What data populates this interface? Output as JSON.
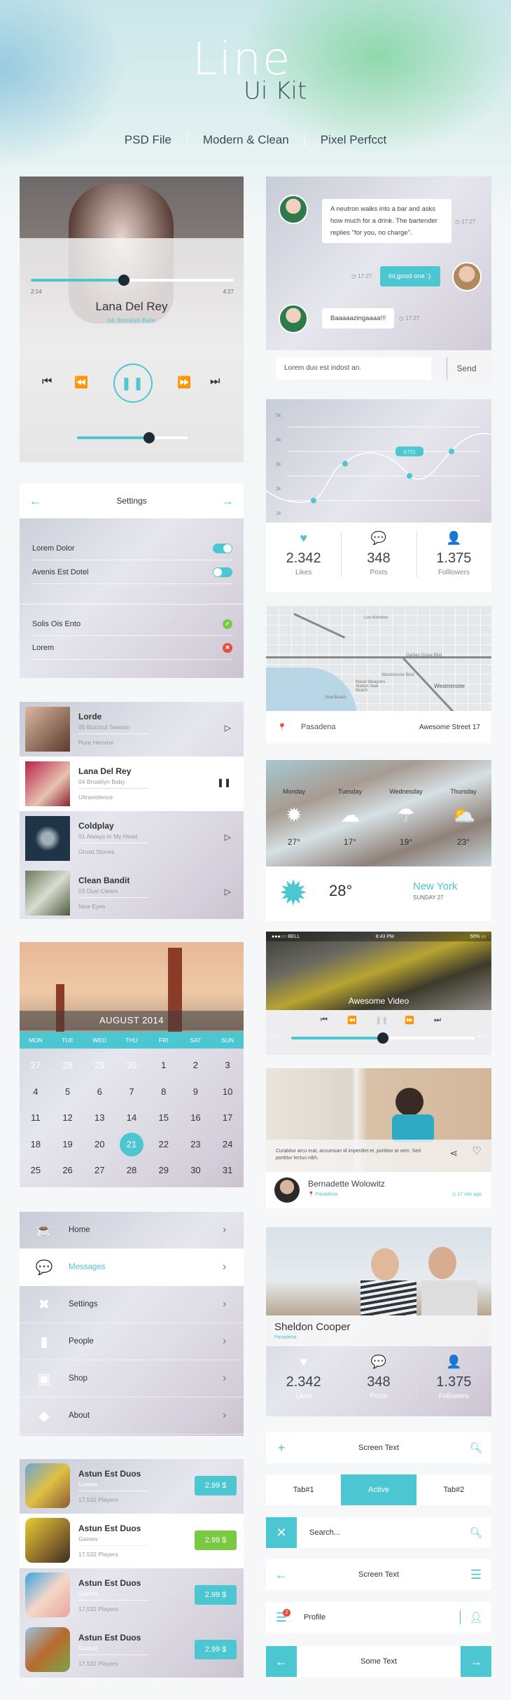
{
  "header": {
    "title_line1": "Line",
    "title_line2": "Ui Kit",
    "features": [
      "PSD File",
      "Modern & Clean",
      "Pixel Perfcct"
    ]
  },
  "colors": {
    "accent": "#4cc7d1",
    "success": "#7ac943",
    "danger": "#e74c3c",
    "text": "#3a4450"
  },
  "music_player": {
    "elapsed": "2:14",
    "duration": "4:27",
    "progress": 0.46,
    "artist": "Lana Del Rey",
    "track": "04. Brooklyn Baby",
    "volume": 0.65,
    "controls": [
      "skip-previous",
      "rewind",
      "pause",
      "fast-forward",
      "skip-next"
    ]
  },
  "chat": {
    "messages": [
      {
        "from": "left",
        "text": "A neutron walks into a bar and asks how much for a drink. The bartender replies \"for you, no charge\".",
        "time": "17:27"
      },
      {
        "from": "right",
        "text": "lol,good one :)",
        "time": "17:27"
      },
      {
        "from": "left",
        "text": "Baaaaazingaaaa!!!",
        "time": "17:27"
      }
    ],
    "input_value": "Lorem duo est indost an.",
    "send_label": "Send"
  },
  "stats_card": {
    "tooltip": "3.721",
    "stats": [
      {
        "icon": "heart-icon",
        "value": "2.342",
        "label": "Likes"
      },
      {
        "icon": "chat-bubbles-icon",
        "value": "348",
        "label": "Posts"
      },
      {
        "icon": "user-icon",
        "value": "1.375",
        "label": "Folllowers"
      }
    ]
  },
  "chart_data": {
    "type": "line",
    "title": "",
    "xlabel": "",
    "ylabel": "",
    "yticks": [
      "5k",
      "4k",
      "3k",
      "2k",
      "1k"
    ],
    "ylim": [
      1000,
      5000
    ],
    "points": [
      1500,
      3000,
      2500,
      3500
    ],
    "highlight": {
      "index": 2,
      "label": "3.721"
    },
    "grid": true
  },
  "settings": {
    "title": "Settings",
    "toggles": [
      {
        "label": "Lorem Dolor",
        "on": true
      },
      {
        "label": "Avenis Est Dotel",
        "on": false
      }
    ],
    "statuses": [
      {
        "label": "Solis Ois Ento",
        "status": "ok"
      },
      {
        "label": "Lorem",
        "status": "error"
      }
    ]
  },
  "map_card": {
    "labels": [
      "Westminster",
      "Seal Beach",
      "Naval Weapons Station Seal Beach",
      "Westminster Blvd",
      "Garden Grove Blvd",
      "Los Alamitos"
    ],
    "place": "Pasadena",
    "address": "Awesome Street 17"
  },
  "music_list": [
    {
      "artist": "Lorde",
      "track": "05 Buzzcut Season",
      "album": "Pure Heroine",
      "state": "play"
    },
    {
      "artist": "Lana Del Rey",
      "track": "04 Brooklyn Baby",
      "album": "Ultraviolence",
      "state": "pause"
    },
    {
      "artist": "Coldplay",
      "track": "01 Always In My Head",
      "album": "Ghost Stories",
      "state": "play"
    },
    {
      "artist": "Clean Bandit",
      "track": "03 Dust Clears",
      "album": "New Eyes",
      "state": "play"
    }
  ],
  "weather": {
    "forecast": [
      {
        "day": "Monday",
        "icon": "sun-icon",
        "temp": "27°"
      },
      {
        "day": "Tuesday",
        "icon": "rain-cloud-icon",
        "temp": "17°"
      },
      {
        "day": "Wednesday",
        "icon": "sun-rain-icon",
        "temp": "19°"
      },
      {
        "day": "Thursday",
        "icon": "partly-cloudy-icon",
        "temp": "23°"
      }
    ],
    "current_temp": "28°",
    "city": "New York",
    "date": "SUNDAY 27"
  },
  "calendar": {
    "month": "AUGUST 2014",
    "weekdays": [
      "MON",
      "TUE",
      "WED",
      "THU",
      "FRI",
      "SAT",
      "SUN"
    ],
    "days": [
      "27",
      "28",
      "29",
      "30",
      "1",
      "2",
      "3",
      "4",
      "5",
      "6",
      "7",
      "8",
      "9",
      "10",
      "11",
      "12",
      "13",
      "14",
      "15",
      "16",
      "17",
      "18",
      "19",
      "20",
      "21",
      "22",
      "23",
      "24",
      "25",
      "26",
      "27",
      "28",
      "29",
      "30",
      "31"
    ],
    "muted_count": 4,
    "selected": "21"
  },
  "video": {
    "carrier": "●●●○○ BELL",
    "clock": "8:43 PM",
    "battery": "50%",
    "title": "Awesome Video",
    "elapsed": "2:14",
    "duration": "4:27",
    "progress": 0.5
  },
  "feed_card": {
    "caption": "Curabitur arcu erat, accumsan id imperdiet et, porttitor at sem. Sed porttitor lectus nibh.",
    "author": "Bernadette Wolowitz",
    "location": "Pasadena",
    "time": "17 min ago"
  },
  "side_menu": [
    {
      "icon": "coffee-cup-icon",
      "label": "Home",
      "active": false
    },
    {
      "icon": "message-icon",
      "label": "Messages",
      "active": true
    },
    {
      "icon": "tools-icon",
      "label": "Settings",
      "active": false
    },
    {
      "icon": "notebook-icon",
      "label": "People",
      "active": false
    },
    {
      "icon": "shop-bag-icon",
      "label": "Shop",
      "active": false
    },
    {
      "icon": "diamond-icon",
      "label": "About",
      "active": false
    }
  ],
  "profile_card": {
    "name": "Sheldon Cooper",
    "location": "Pasadena",
    "stats": [
      {
        "icon": "heart-icon",
        "value": "2.342",
        "label": "Likes"
      },
      {
        "icon": "chat-bubbles-icon",
        "value": "348",
        "label": "Posts"
      },
      {
        "icon": "user-icon",
        "value": "1.375",
        "label": "Followers"
      }
    ]
  },
  "store": [
    {
      "title": "Astun Est Duos",
      "category": "Games",
      "players": "17,532 Players",
      "price": "2.99 $",
      "highlight": false
    },
    {
      "title": "Astun Est Duos",
      "category": "Games",
      "players": "17,532 Players",
      "price": "2.99 $",
      "highlight": true
    },
    {
      "title": "Astun Est Duos",
      "category": "Games",
      "players": "17,532 Players",
      "price": "2.99 $",
      "highlight": false
    },
    {
      "title": "Astun Est Duos",
      "category": "Games",
      "players": "17,532 Players",
      "price": "2.99 $",
      "highlight": false
    }
  ],
  "nav_bars": {
    "bar1_title": "Screen Text",
    "tabs": [
      "Tab#1",
      "Active",
      "Tab#2"
    ],
    "search_placeholder": "Search...",
    "bar2_title": "Screen Text",
    "profile_label": "Profile",
    "badge_count": "2",
    "bar3_title": "Some Text"
  }
}
